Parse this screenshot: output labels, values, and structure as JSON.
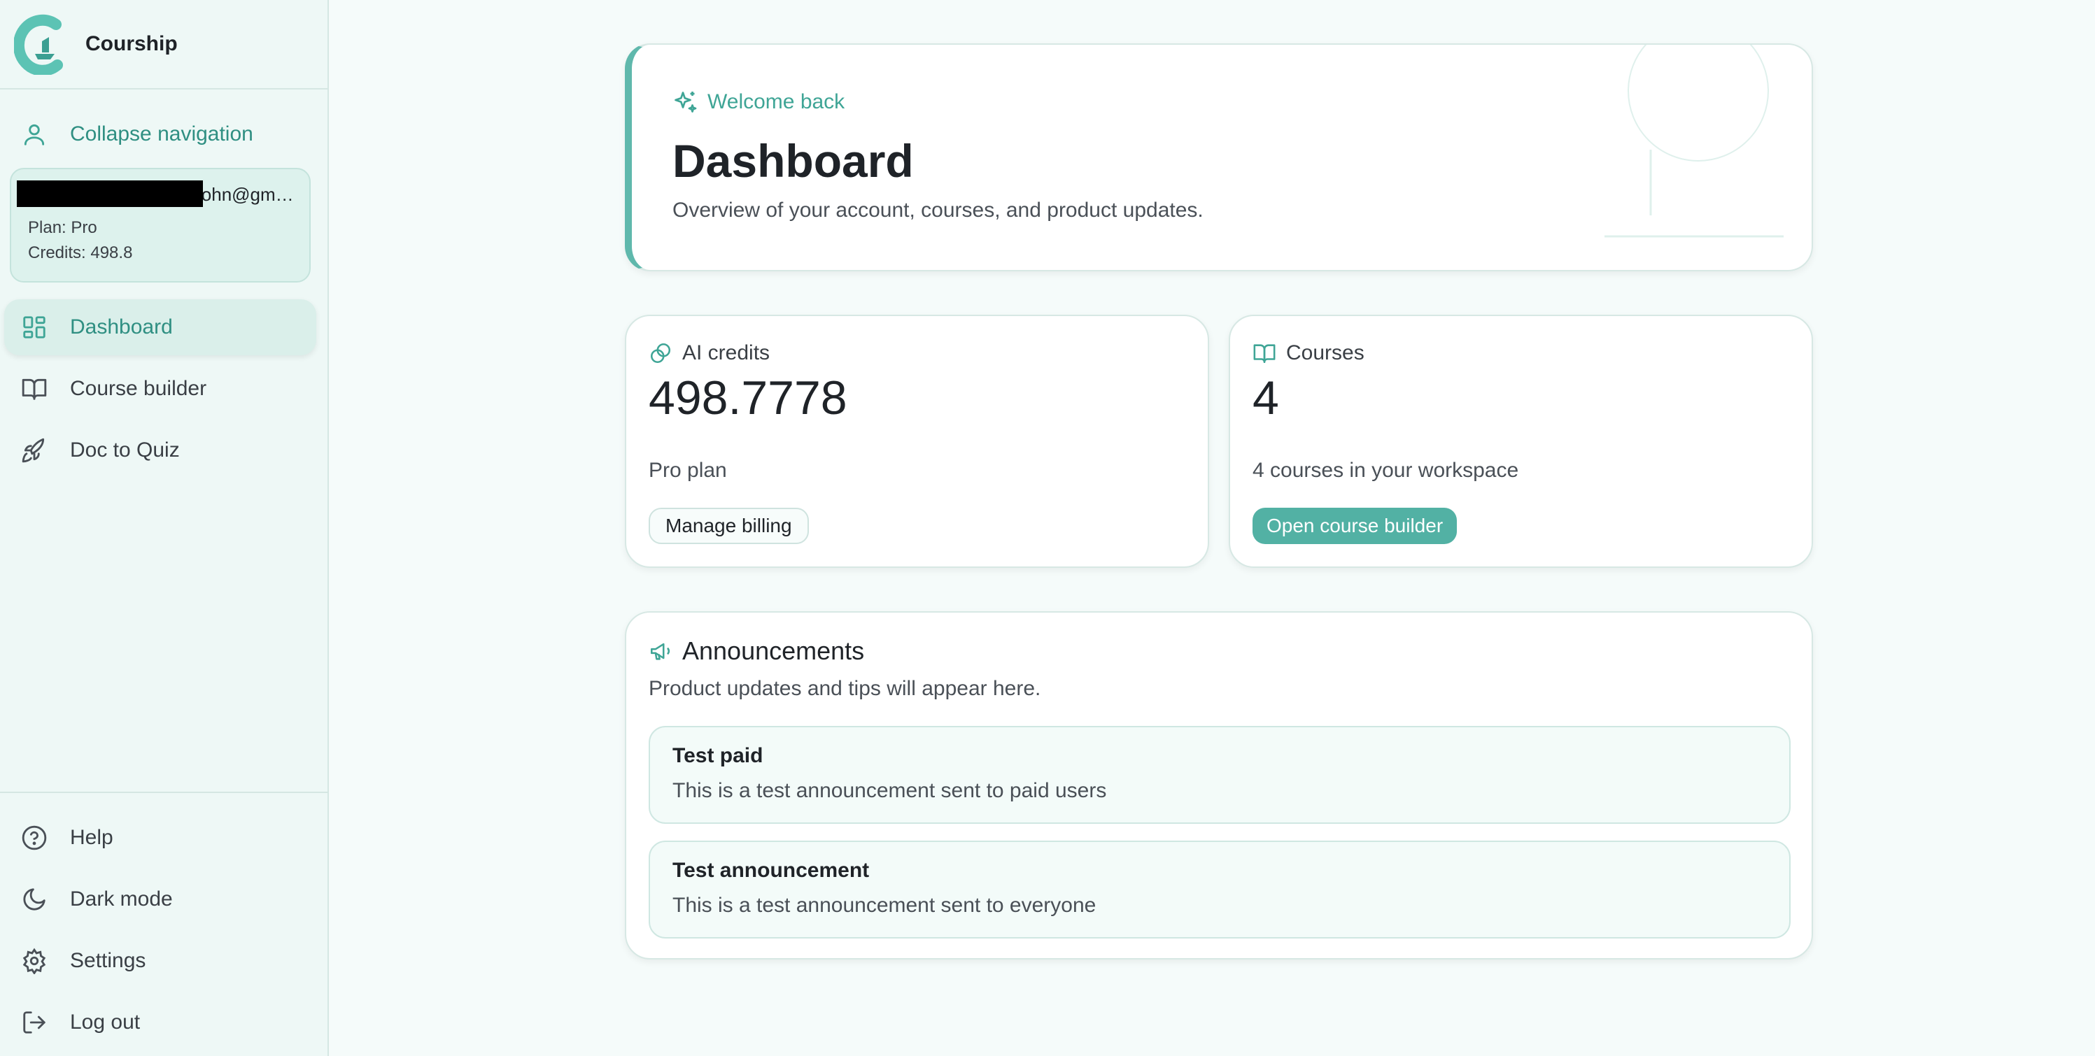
{
  "app": {
    "name": "Courship"
  },
  "sidebar": {
    "collapse_label": "Collapse navigation",
    "account": {
      "email": "john@gm…",
      "plan": "Plan: Pro",
      "credits": "Credits: 498.8"
    },
    "nav": [
      {
        "label": "Dashboard",
        "icon": "dashboard-icon",
        "active": true
      },
      {
        "label": "Course builder",
        "icon": "book-icon"
      },
      {
        "label": "Doc to Quiz",
        "icon": "rocket-icon"
      }
    ],
    "footer": [
      {
        "label": "Help",
        "icon": "help-icon"
      },
      {
        "label": "Dark mode",
        "icon": "moon-icon"
      },
      {
        "label": "Settings",
        "icon": "gear-icon"
      },
      {
        "label": "Log out",
        "icon": "logout-icon"
      }
    ]
  },
  "hero": {
    "kicker": "Welcome back",
    "title": "Dashboard",
    "subtitle": "Overview of your account, courses, and product updates."
  },
  "credits_card": {
    "label": "AI credits",
    "value": "498.7778",
    "note": "Pro plan",
    "button": "Manage billing"
  },
  "courses_card": {
    "label": "Courses",
    "value": "4",
    "note": "4 courses in your workspace",
    "button": "Open course builder"
  },
  "announcements": {
    "title": "Announcements",
    "subtitle": "Product updates and tips will appear here.",
    "items": [
      {
        "title": "Test paid",
        "body": "This is a test announcement sent to paid users"
      },
      {
        "title": "Test announcement",
        "body": "This is a test announcement sent to everyone"
      }
    ]
  },
  "colors": {
    "accent": "#52b1a4",
    "sidebar_bg": "#eef8f6",
    "page_bg": "#f5fbfa"
  }
}
